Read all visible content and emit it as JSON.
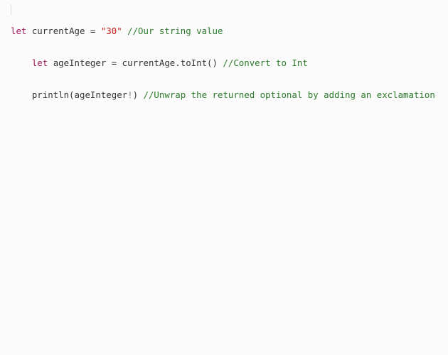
{
  "editor": {
    "lines": [
      {
        "indent": "",
        "tokens": [
          {
            "type": "kw",
            "text": "let"
          },
          {
            "type": "plain",
            "text": " currentAge = "
          },
          {
            "type": "str",
            "text": "\"30\""
          },
          {
            "type": "plain",
            "text": " "
          },
          {
            "type": "cmt",
            "text": "//Our string value"
          }
        ]
      },
      {
        "indent": "    ",
        "tokens": [
          {
            "type": "kw",
            "text": "let"
          },
          {
            "type": "plain",
            "text": " ageInteger = currentAge.toInt() "
          },
          {
            "type": "cmt",
            "text": "//Convert to Int"
          }
        ]
      },
      {
        "indent": "    ",
        "tokens": [
          {
            "type": "plain",
            "text": "println(ageInteger"
          },
          {
            "type": "punc",
            "text": "!"
          },
          {
            "type": "plain",
            "text": ") "
          },
          {
            "type": "cmt",
            "text": "//Unwrap the returned optional by adding an exclamation"
          }
        ]
      }
    ]
  }
}
